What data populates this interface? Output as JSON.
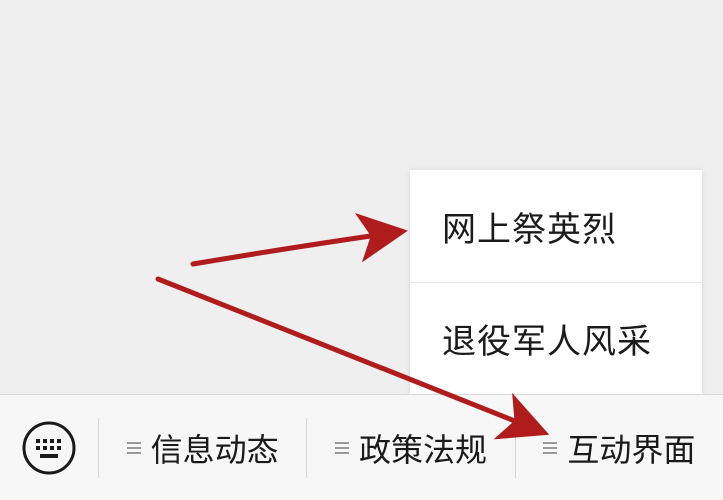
{
  "popup_menu": {
    "items": [
      {
        "label": "网上祭英烈"
      },
      {
        "label": "退役军人风采"
      }
    ]
  },
  "menu_bar": {
    "keyboard_icon": "keyboard-icon",
    "tabs": [
      {
        "label": "信息动态",
        "icon": "menu-lines-icon"
      },
      {
        "label": "政策法规",
        "icon": "menu-lines-icon"
      },
      {
        "label": "互动界面",
        "icon": "menu-lines-icon"
      }
    ]
  },
  "colors": {
    "background": "#efefef",
    "menu_bar": "#f7f7f7",
    "annotation_arrow": "#b01c1c"
  }
}
